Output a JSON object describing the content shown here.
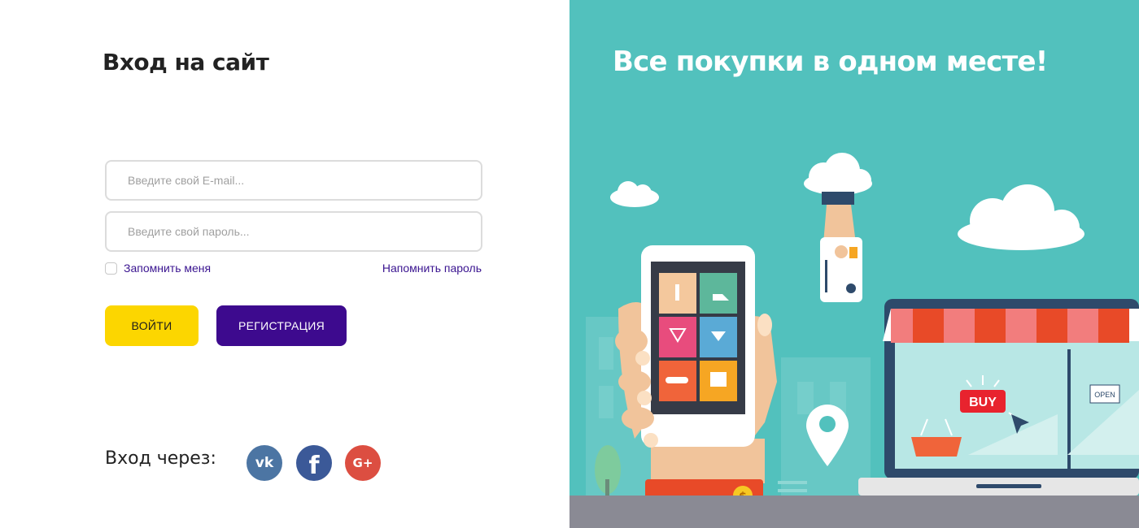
{
  "login": {
    "title": "Вход на сайт",
    "email_placeholder": "Введите свой E-mail...",
    "password_placeholder": "Введите свой пароль...",
    "remember_label": "Запомнить меня",
    "forgot_label": "Напомнить пароль",
    "login_button": "ВОЙТИ",
    "register_button": "РЕГИСТРАЦИЯ",
    "social_label": "Вход через:",
    "social": [
      {
        "name": "vk",
        "icon": "vk-icon",
        "glyph": "vk",
        "color": "#4c75a3"
      },
      {
        "name": "facebook",
        "icon": "facebook-icon",
        "glyph": "f",
        "color": "#3b5998"
      },
      {
        "name": "google-plus",
        "icon": "google-plus-icon",
        "glyph": "G+",
        "color": "#dc4e41"
      }
    ]
  },
  "promo": {
    "title": "Все покупки в одном месте!",
    "background": "#52c1bd",
    "shop_buy_label": "BUY",
    "shop_open_label": "OPEN",
    "coin_symbol": "$"
  },
  "colors": {
    "accent_yellow": "#fcd600",
    "accent_purple": "#3d0a8e",
    "link": "#3a1490"
  }
}
